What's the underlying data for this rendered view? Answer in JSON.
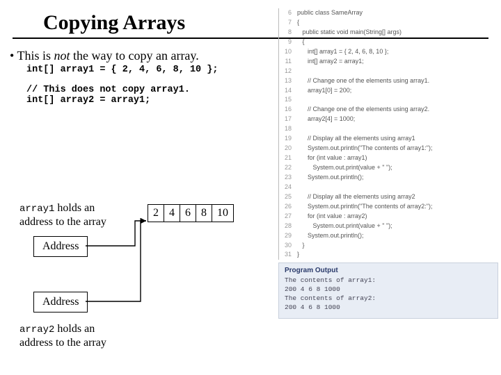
{
  "title": "Copying Arrays",
  "bullet_prefix": "• This is ",
  "bullet_em": "not",
  "bullet_suffix": " the way to copy an array.",
  "code1": "int[] array1 = { 2, 4, 6, 8, 10 };",
  "code2": "// This does not copy array1.\nint[] array2 = array1;",
  "label1_mono": "array1",
  "label1_rest": " holds an address to the array",
  "label2_mono": "array2",
  "label2_rest": " holds an address to the array",
  "address": "Address",
  "cells": [
    "2",
    "4",
    "6",
    "8",
    "10"
  ],
  "listing": [
    {
      "n": "6",
      "t": "public class SameArray"
    },
    {
      "n": "7",
      "t": "{"
    },
    {
      "n": "8",
      "t": "   public static void main(String[] args)"
    },
    {
      "n": "9",
      "t": "   {"
    },
    {
      "n": "10",
      "t": "      int[] array1 = { 2, 4, 6, 8, 10 };"
    },
    {
      "n": "11",
      "t": "      int[] array2 = array1;"
    },
    {
      "n": "12",
      "t": ""
    },
    {
      "n": "13",
      "t": "      // Change one of the elements using array1."
    },
    {
      "n": "14",
      "t": "      array1[0] = 200;"
    },
    {
      "n": "15",
      "t": ""
    },
    {
      "n": "16",
      "t": "      // Change one of the elements using array2."
    },
    {
      "n": "17",
      "t": "      array2[4] = 1000;"
    },
    {
      "n": "18",
      "t": ""
    },
    {
      "n": "19",
      "t": "      // Display all the elements using array1"
    },
    {
      "n": "20",
      "t": "      System.out.println(\"The contents of array1:\");"
    },
    {
      "n": "21",
      "t": "      for (int value : array1)"
    },
    {
      "n": "22",
      "t": "         System.out.print(value + \" \");"
    },
    {
      "n": "23",
      "t": "      System.out.println();"
    },
    {
      "n": "24",
      "t": ""
    },
    {
      "n": "25",
      "t": "      // Display all the elements using array2"
    },
    {
      "n": "26",
      "t": "      System.out.println(\"The contents of array2:\");"
    },
    {
      "n": "27",
      "t": "      for (int value : array2)"
    },
    {
      "n": "28",
      "t": "         System.out.print(value + \" \");"
    },
    {
      "n": "29",
      "t": "      System.out.println();"
    },
    {
      "n": "30",
      "t": "   }"
    },
    {
      "n": "31",
      "t": "}"
    }
  ],
  "output_header": "Program Output",
  "output_lines": [
    "The contents of array1:",
    "200 4 6 8 1000",
    "The contents of array2:",
    "200 4 6 8 1000"
  ]
}
